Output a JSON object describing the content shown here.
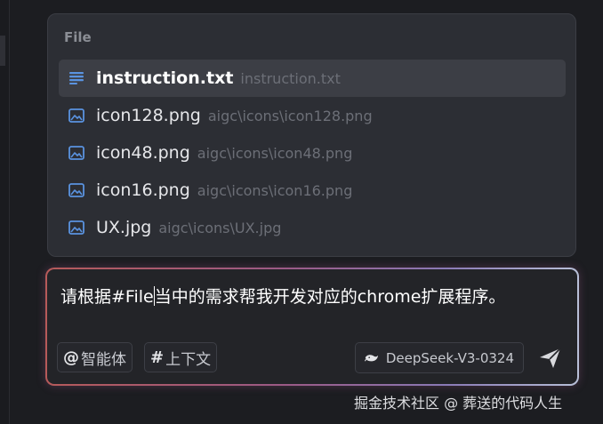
{
  "file_popup": {
    "title": "File",
    "items": [
      {
        "name": "instruction.txt",
        "path": "instruction.txt",
        "icon": "text-file-icon",
        "selected": true
      },
      {
        "name": "icon128.png",
        "path": "aigc\\icons\\icon128.png",
        "icon": "image-file-icon",
        "selected": false
      },
      {
        "name": "icon48.png",
        "path": "aigc\\icons\\icon48.png",
        "icon": "image-file-icon",
        "selected": false
      },
      {
        "name": "icon16.png",
        "path": "aigc\\icons\\icon16.png",
        "icon": "image-file-icon",
        "selected": false
      },
      {
        "name": "UX.jpg",
        "path": "aigc\\icons\\UX.jpg",
        "icon": "image-file-icon",
        "selected": false
      }
    ]
  },
  "input": {
    "text_before_caret": "请根据#File",
    "text_after_caret": "当中的需求帮我开发对应的chrome扩展程序。"
  },
  "toolbar": {
    "agent_symbol": "@",
    "agent_label": "智能体",
    "context_symbol": "#",
    "context_label": "上下文",
    "model_label": "DeepSeek-V3-0324",
    "model_icon": "deepseek-whale-icon",
    "send_icon": "send-icon"
  },
  "watermark": "掘金技术社区 @ 葬送的代码人生",
  "colors": {
    "accent_icon": "#5a93e0",
    "background": "#1c1d21",
    "popup": "#2c2e34",
    "selected_row": "#3c3e45"
  }
}
